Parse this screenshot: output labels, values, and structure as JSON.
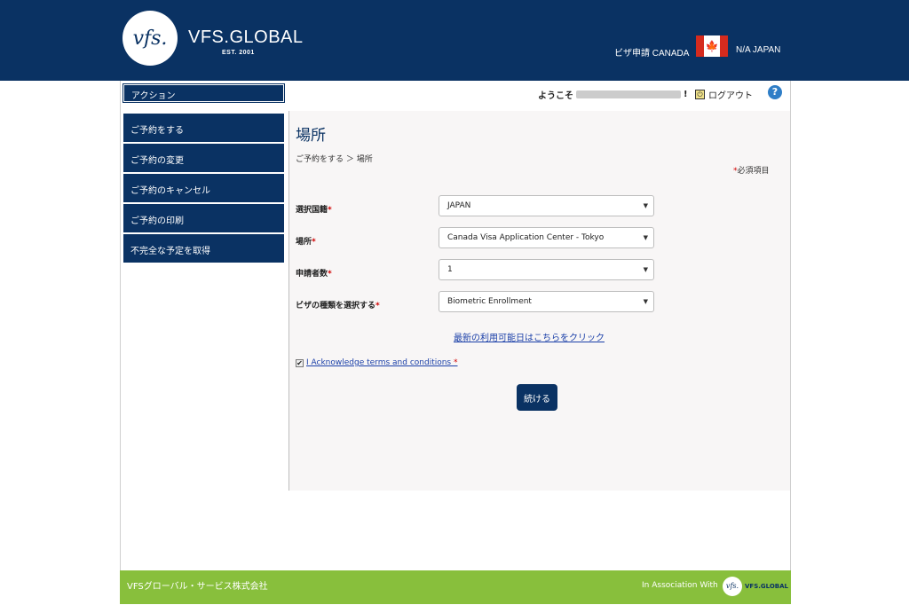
{
  "header": {
    "logo_mark": "vfs.",
    "logo_name": "VFS.GLOBAL",
    "logo_est": "EST. 2001",
    "visa_label": "ビザ申請 CANADA",
    "flag_symbol": "🍁",
    "region_label": "N/A JAPAN"
  },
  "sidebar": {
    "title": "アクション",
    "items": [
      {
        "label": "ご予約をする"
      },
      {
        "label": "ご予約の変更"
      },
      {
        "label": "ご予約のキャンセル"
      },
      {
        "label": "ご予約の印刷"
      },
      {
        "label": "不完全な予定を取得"
      }
    ]
  },
  "topbar": {
    "welcome": "ようこそ",
    "welcome_suffix": "!",
    "logout": "ログアウト",
    "power_glyph": "⏻",
    "help_glyph": "?"
  },
  "main": {
    "title": "場所",
    "breadcrumb": "ご予約をする ＞ 場所",
    "required_star": "*",
    "required_note": "必須項目",
    "fields": [
      {
        "label": "選択国籍",
        "value": "JAPAN"
      },
      {
        "label": "場所",
        "value": "Canada Visa Application Center - Tokyo"
      },
      {
        "label": "申請者数",
        "value": "1"
      },
      {
        "label": "ビザの種類を選択する",
        "value": "Biometric Enrollment"
      }
    ],
    "caret": "▼",
    "availability_link": "最新の利用可能日はこちらをクリック",
    "checkbox_mark": "✔",
    "ack_text": "I Acknowledge terms and conditions ",
    "ack_star": "*",
    "continue_label": "続ける"
  },
  "footer": {
    "company": "VFSグローバル・サービス株式会社",
    "association": "In Association With",
    "logo_mark": "vfs.",
    "logo_name": "VFS.GLOBAL"
  },
  "colors": {
    "navy": "#0a3263",
    "footer_green": "#88bf3c",
    "link_blue": "#1a3fa8",
    "required_red": "#d00000"
  }
}
